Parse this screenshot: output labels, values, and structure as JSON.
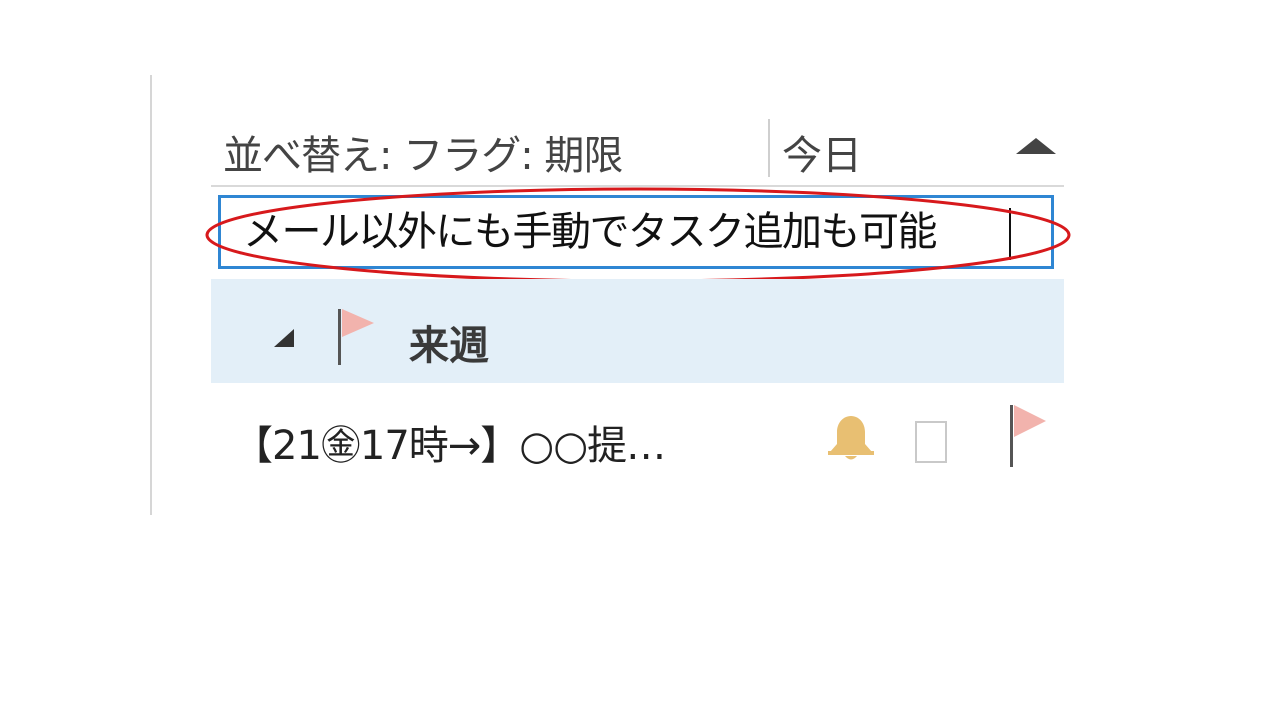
{
  "header": {
    "sort_label": "並べ替え: フラグ: 期限",
    "today_label": "今日"
  },
  "new_task": {
    "value": "メール以外にも手動でタスク追加も可能"
  },
  "group": {
    "label": "来週"
  },
  "tasks": [
    {
      "title": "【21㊎17時→】○○提…",
      "reminder": "bell-icon",
      "flagged": true
    }
  ],
  "colors": {
    "input_border": "#2f86d3",
    "annotation_ellipse": "#d7191c",
    "group_background": "#e3eff8",
    "flag": "#f2b3ad",
    "bell": "#e8bf72"
  }
}
